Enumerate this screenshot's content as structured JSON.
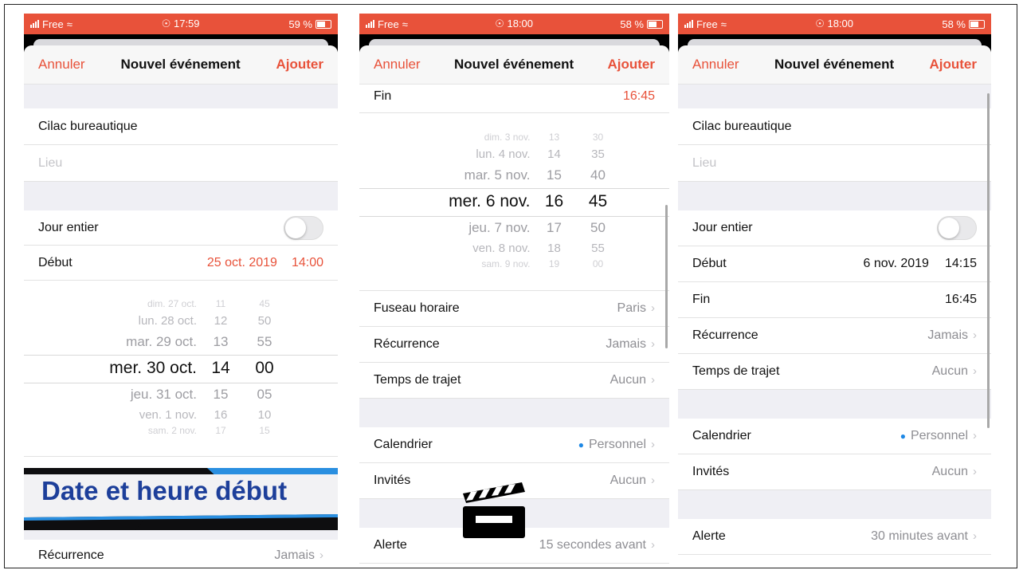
{
  "status": {
    "carrier": "Free",
    "p1_time": "17:59",
    "p1_battery": "59 %",
    "p2_time": "18:00",
    "p2_battery": "58 %",
    "p3_time": "18:00",
    "p3_battery": "58 %"
  },
  "nav": {
    "cancel": "Annuler",
    "title": "Nouvel événement",
    "add": "Ajouter"
  },
  "form": {
    "title_value": "Cilac bureautique",
    "location_placeholder": "Lieu",
    "all_day": "Jour entier",
    "start": "Début",
    "end": "Fin",
    "timezone": "Fuseau horaire",
    "recurrence": "Récurrence",
    "travel": "Temps de trajet",
    "calendar": "Calendrier",
    "invitees": "Invités",
    "alert": "Alerte"
  },
  "values": {
    "p1_start_date": "25 oct. 2019",
    "p1_start_time": "14:00",
    "p2_end_time": "16:45",
    "timezone": "Paris",
    "never": "Jamais",
    "none": "Aucun",
    "calendar": "Personnel",
    "p2_alert": "15 secondes avant",
    "p3_start_date": "6 nov. 2019",
    "p3_start_time": "14:15",
    "p3_end_time": "16:45",
    "p3_alert": "30 minutes avant"
  },
  "picker1": [
    {
      "day": "dim. 27 oct.",
      "h": "11",
      "m": "45"
    },
    {
      "day": "lun. 28 oct.",
      "h": "12",
      "m": "50"
    },
    {
      "day": "mar. 29 oct.",
      "h": "13",
      "m": "55"
    },
    {
      "day": "mer. 30 oct.",
      "h": "14",
      "m": "00"
    },
    {
      "day": "jeu. 31 oct.",
      "h": "15",
      "m": "05"
    },
    {
      "day": "ven. 1 nov.",
      "h": "16",
      "m": "10"
    },
    {
      "day": "sam. 2 nov.",
      "h": "17",
      "m": "15"
    }
  ],
  "picker2": [
    {
      "day": "dim. 3 nov.",
      "h": "13",
      "m": "30"
    },
    {
      "day": "lun. 4 nov.",
      "h": "14",
      "m": "35"
    },
    {
      "day": "mar. 5 nov.",
      "h": "15",
      "m": "40"
    },
    {
      "day": "mer. 6 nov.",
      "h": "16",
      "m": "45"
    },
    {
      "day": "jeu. 7 nov.",
      "h": "17",
      "m": "50"
    },
    {
      "day": "ven. 8 nov.",
      "h": "18",
      "m": "55"
    },
    {
      "day": "sam. 9 nov.",
      "h": "19",
      "m": "00"
    }
  ],
  "banner": {
    "text": "Date et heure début"
  },
  "colors": {
    "accent": "#e8523a",
    "banner_text": "#1d3f9a",
    "calendar_dot": "#1e88e5"
  },
  "icons": {
    "clapper": "clapperboard-icon"
  }
}
